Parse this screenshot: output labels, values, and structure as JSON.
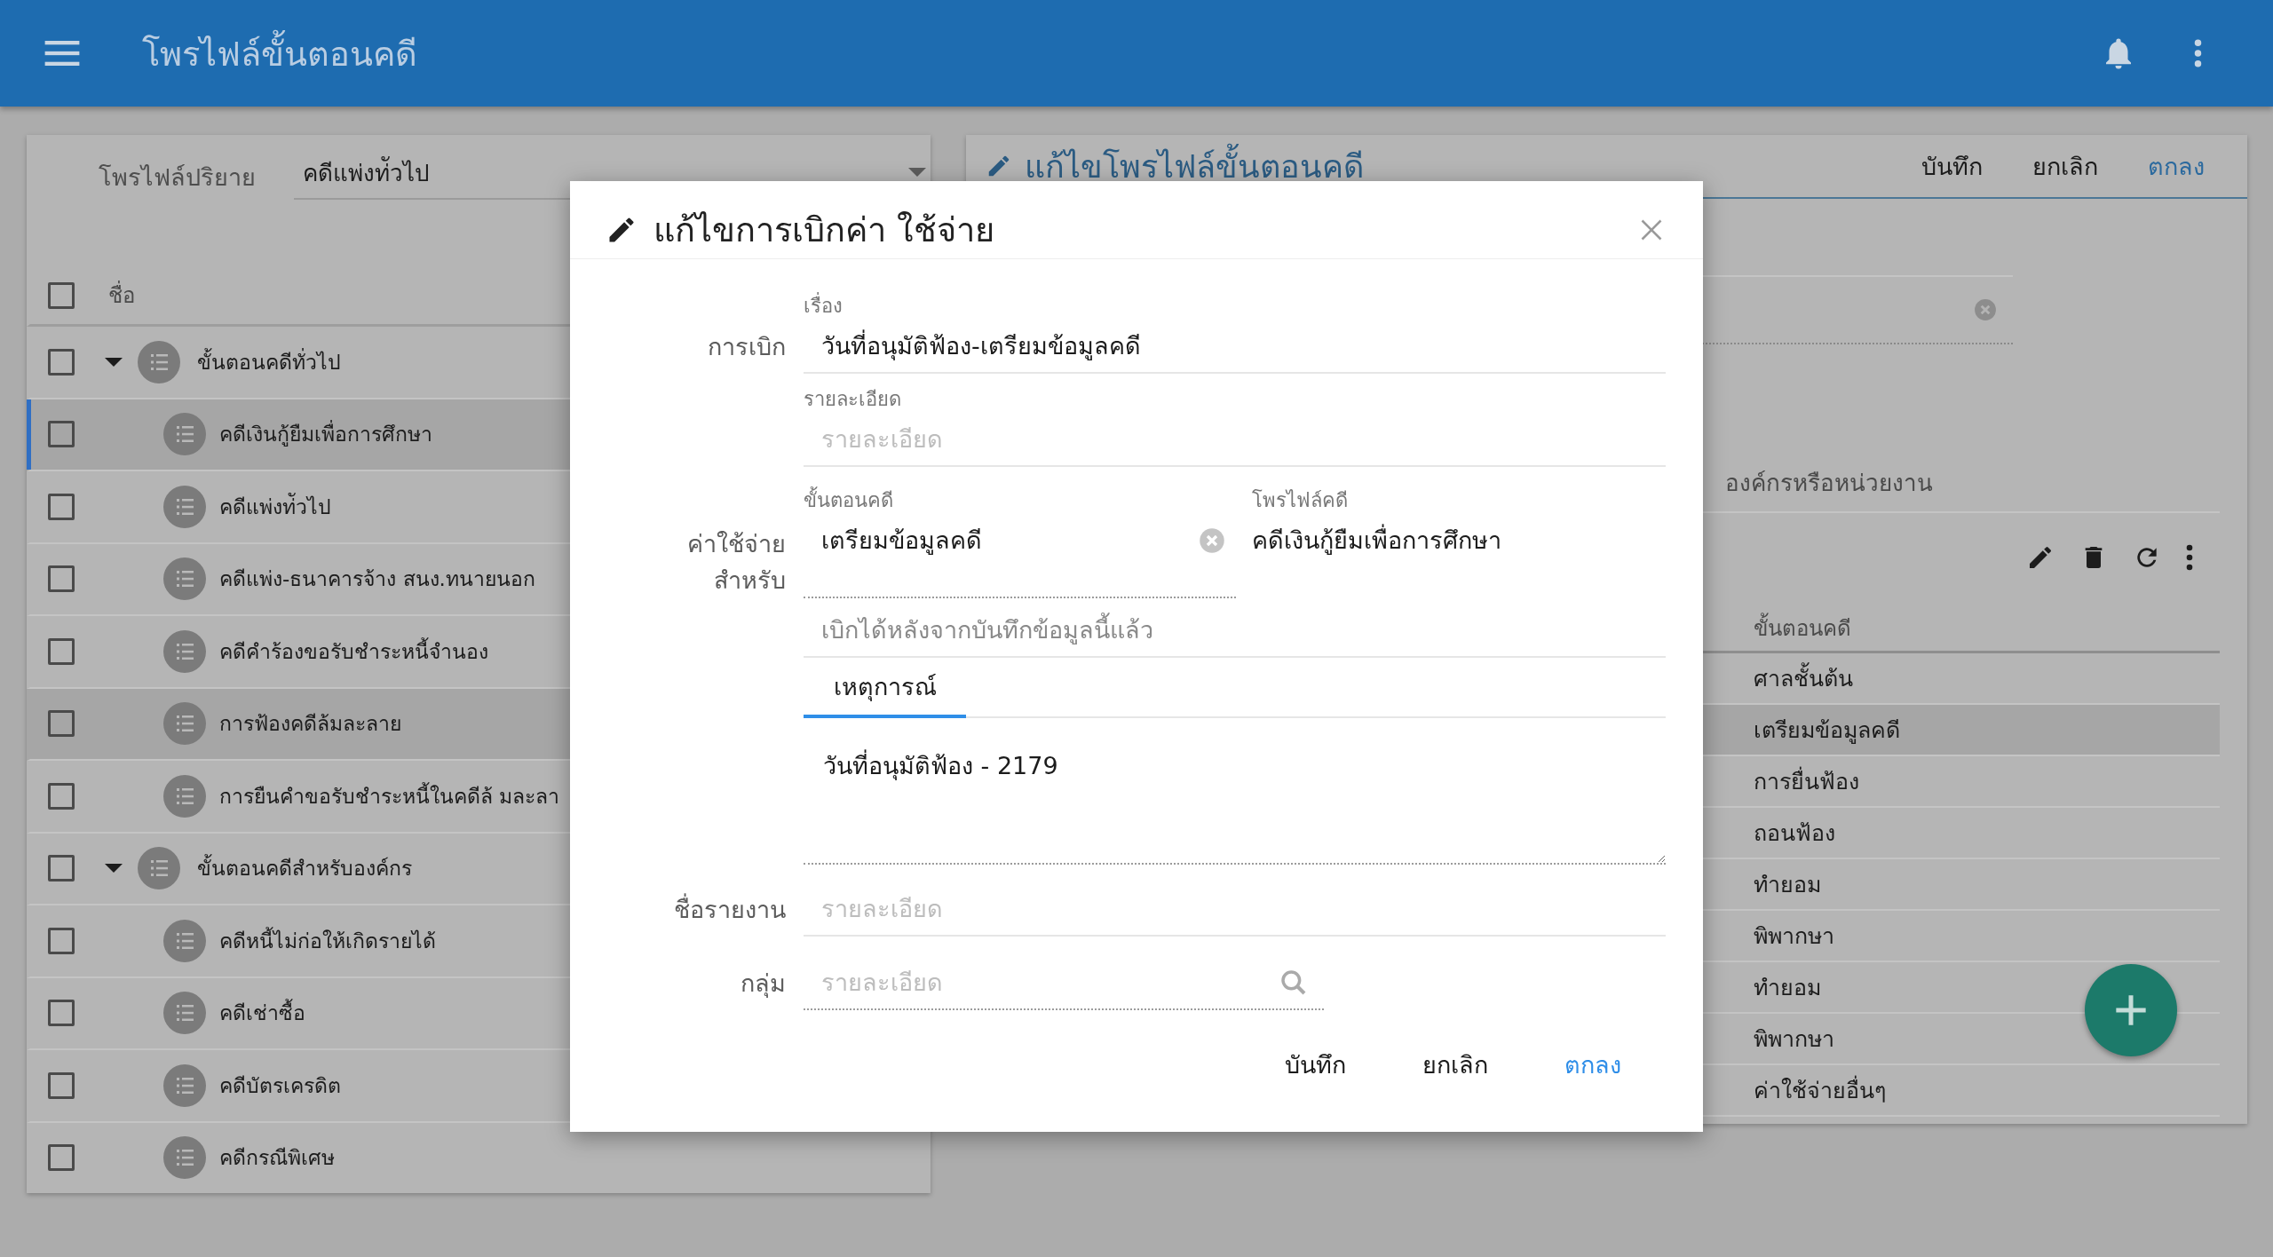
{
  "app_bar": {
    "title": "โพรไฟล์ขั้นตอนคดี"
  },
  "profile_list": {
    "default_label": "โพรไฟล์ปริยาย",
    "default_value": "คดีแพ่งท่ัวไป",
    "header": {
      "label": "ชื่อ",
      "checked": false
    },
    "groups": [
      {
        "label": "ขั้นตอนคดีทั่วไป",
        "expanded": true,
        "checked": false,
        "selected": false,
        "focused": false,
        "children": [
          {
            "label": "คดีเงินกู้ยืมเพื่อการศึกษา",
            "checked": false,
            "selected": true,
            "focused": true
          },
          {
            "label": "คดีแพ่งท่ัวไป",
            "checked": false,
            "selected": false,
            "focused": false
          },
          {
            "label": "คดีแพ่ง-ธนาคารจ้าง สนง.ทนายนอก",
            "checked": false,
            "selected": false,
            "focused": false
          },
          {
            "label": "คดีคำร้องขอรับชำระหนี้จำนอง",
            "checked": false,
            "selected": false,
            "focused": false
          },
          {
            "label": "การฟ้องคดีล้มละลาย",
            "checked": false,
            "selected": true,
            "focused": false
          },
          {
            "label": "การยืนคำขอรับชำระหนี้ในคดีล้ มละลา",
            "checked": false,
            "selected": false,
            "focused": false
          }
        ]
      },
      {
        "label": "ขั้นตอนคดีสำหรับองค์กร",
        "expanded": true,
        "checked": false,
        "selected": false,
        "focused": false,
        "children": [
          {
            "label": "คดีหนี้ไม่ก่อให้เกิดรายได้",
            "checked": false,
            "selected": false,
            "focused": false
          },
          {
            "label": "คดีเช่าซื้อ",
            "checked": false,
            "selected": false,
            "focused": false
          },
          {
            "label": "คดีบัตรเครดิต",
            "checked": false,
            "selected": false,
            "focused": false
          },
          {
            "label": "คดีกรณีพิเศษ",
            "checked": false,
            "selected": false,
            "focused": false
          }
        ]
      }
    ]
  },
  "profile_editor": {
    "title": "แก้ไขโพรไฟล์ขั้นตอนคดี",
    "buttons": [
      {
        "label": "บันทึก",
        "kind": "plain"
      },
      {
        "label": "ยกเลิก",
        "kind": "plain"
      },
      {
        "label": "ตกลง",
        "kind": "primary"
      }
    ],
    "org_label": "องค์กรหรือหน่วยงาน",
    "table": {
      "column": "ขั้นตอนคดี",
      "rows": [
        {
          "label": "ศาลชั้นต้น",
          "selected": false
        },
        {
          "label": "เตรียมข้อมูลคดี",
          "selected": true
        },
        {
          "label": "การยื่นฟ้อง",
          "selected": false
        },
        {
          "label": "ถอนฟ้อง",
          "selected": false
        },
        {
          "label": "ทำยอม",
          "selected": false
        },
        {
          "label": "พิพากษา",
          "selected": false
        },
        {
          "label": "ทำยอม",
          "selected": false
        },
        {
          "label": "พิพากษา",
          "selected": false
        },
        {
          "label": "ค่าใช้จ่ายอื่นๆ",
          "selected": false
        }
      ]
    }
  },
  "dialog": {
    "title": "แก้ไขการเบิกค่า ใช้จ่าย",
    "claim_label": "การเบิก",
    "subject": {
      "label": "เรื่อง",
      "value": "วันที่อนุมัติฟ้อง-เตรียมข้อมูลคดี"
    },
    "detail": {
      "label": "รายละเอียด",
      "placeholder": "รายละเอียด"
    },
    "expense_for_label": "ค่าใช้จ่าย สำหรับ",
    "step": {
      "label": "ขั้นตอนคดี",
      "value": "เตรียมข้อมูลคดี"
    },
    "profile": {
      "label": "โพรไฟล์คดี",
      "value": "คดีเงินกู้ยืมเพื่อการศึกษา"
    },
    "claim_after": {
      "placeholder": "เบิกได้หลังจากบันทึกข้อมูลนี้แล้ว"
    },
    "tabs": [
      {
        "label": "เหตุการณ์",
        "selected": true
      }
    ],
    "event_text": "วันที่อนุมัติฟ้อง - 2179",
    "report": {
      "label": "ชื่อรายงาน",
      "placeholder": "รายละเอียด"
    },
    "group": {
      "label": "กลุ่ม",
      "placeholder": "รายละเอียด"
    },
    "buttons": [
      {
        "label": "บันทึก",
        "kind": "plain"
      },
      {
        "label": "ยกเลิก",
        "kind": "plain"
      },
      {
        "label": "ตกลง",
        "kind": "primary"
      }
    ]
  }
}
